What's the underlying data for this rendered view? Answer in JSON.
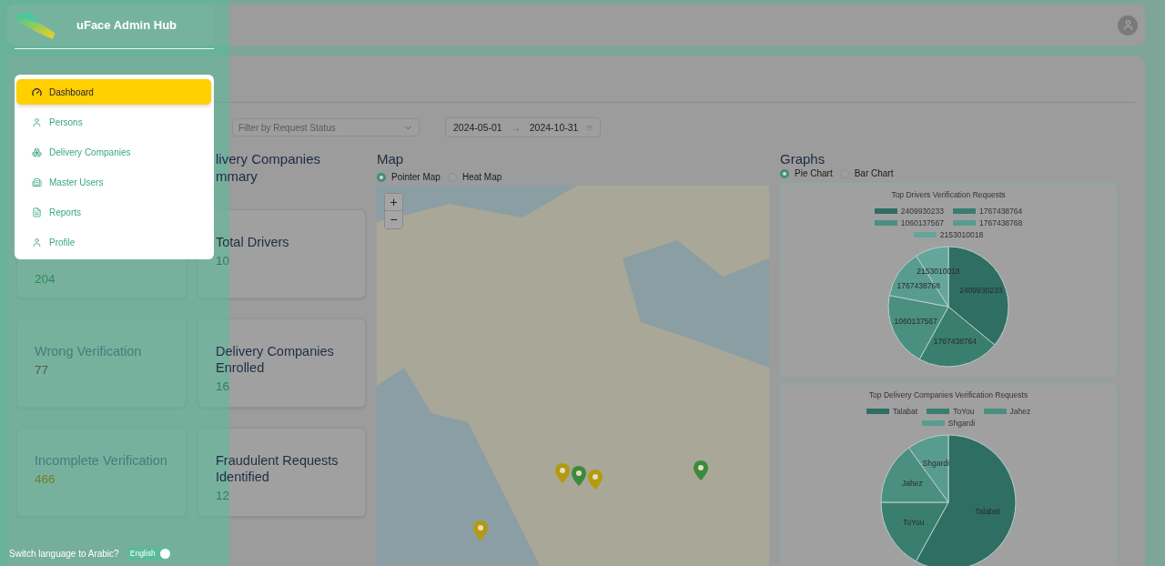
{
  "app": {
    "title": "uFace Admin Hub"
  },
  "menu": [
    {
      "label": "Dashboard",
      "selected": true
    },
    {
      "label": "Persons",
      "selected": false
    },
    {
      "label": "Delivery Companies",
      "selected": false
    },
    {
      "label": "Master Users",
      "selected": false
    },
    {
      "label": "Reports",
      "selected": false
    },
    {
      "label": "Profile",
      "selected": false
    }
  ],
  "language": {
    "prompt": "Switch language to Arabic?",
    "toggle_label": "English",
    "on": true
  },
  "filters": {
    "status": {
      "placeholder": "Filter by Request Status"
    },
    "date_from": "2024-05-01",
    "separator": "→",
    "date_to": "2024-10-31"
  },
  "drivers_summary": {
    "cards": [
      {
        "value": "204",
        "color": "#2e8a58"
      },
      {
        "label": "Wrong Verification",
        "value": "77",
        "color": "#5c5446"
      },
      {
        "label": "Incomplete Verification",
        "value": "466",
        "color": "#6f7f22"
      }
    ]
  },
  "companies_summary": {
    "title_lines": [
      "livery Companies",
      "mmary"
    ],
    "cards": [
      {
        "label": "Total Drivers",
        "value": "10"
      },
      {
        "label": "Delivery Companies Enrolled",
        "value": "16"
      },
      {
        "label": "Fraudulent Requests Identified",
        "value": "12"
      }
    ]
  },
  "map": {
    "title": "Map",
    "modes": [
      {
        "label": "Pointer Map",
        "selected": true
      },
      {
        "label": "Heat Map",
        "selected": false
      }
    ],
    "zoom_in": "+",
    "zoom_out": "−"
  },
  "graphs": {
    "title": "Graphs",
    "modes": [
      {
        "label": "Pie Chart",
        "selected": true
      },
      {
        "label": "Bar Chart",
        "selected": false
      }
    ],
    "charts": [
      {
        "title": "Top Drivers Verification Requests",
        "legend": [
          {
            "label": "2409930233",
            "color": "#2f6e62"
          },
          {
            "label": "1767438764",
            "color": "#3a7e6f"
          },
          {
            "label": "1060137567",
            "color": "#4a8f80"
          },
          {
            "label": "1767438768",
            "color": "#589c8f"
          },
          {
            "label": "2153010018",
            "color": "#64a59c"
          }
        ],
        "slice_labels": [
          "2153010018",
          "1767438768",
          "2409930233",
          "1060137567",
          "1767438764"
        ]
      },
      {
        "title": "Top Delivery Companies Verification Requests",
        "legend": [
          {
            "label": "Talabat",
            "color": "#2f6e62"
          },
          {
            "label": "ToYou",
            "color": "#3a7e6f"
          },
          {
            "label": "Jahez",
            "color": "#4a8f80"
          },
          {
            "label": "Shgardi",
            "color": "#589c8f"
          }
        ],
        "slice_labels": [
          "Shgardi",
          "Jahez",
          "Talabat",
          "ToYou"
        ]
      }
    ]
  }
}
